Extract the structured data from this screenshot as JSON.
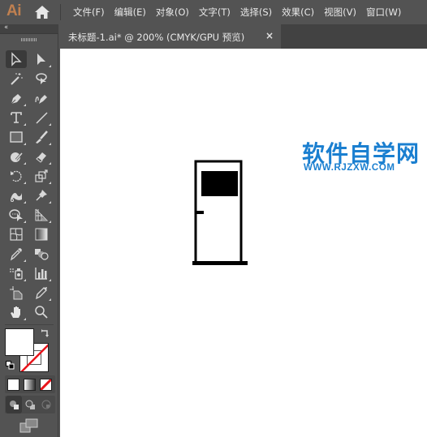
{
  "app": {
    "logo": "Ai",
    "home_icon": "home-icon"
  },
  "menu": [
    "文件(F)",
    "编辑(E)",
    "对象(O)",
    "文字(T)",
    "选择(S)",
    "效果(C)",
    "视图(V)",
    "窗口(W)"
  ],
  "panel": {
    "collapse_glyph": "‹‹"
  },
  "document_tab": {
    "title": "未标题-1.ai* @ 200% (CMYK/GPU 预览)",
    "close_glyph": "×"
  },
  "tools": [
    [
      "selection-tool",
      "direct-selection-tool"
    ],
    [
      "magic-wand-tool",
      "lasso-tool"
    ],
    [
      "pen-tool",
      "curvature-tool"
    ],
    [
      "type-tool",
      "line-segment-tool"
    ],
    [
      "rectangle-tool",
      "paintbrush-tool"
    ],
    [
      "shaper-tool",
      "eraser-tool"
    ],
    [
      "rotate-tool",
      "scale-tool"
    ],
    [
      "warp-tool",
      "puppet-warp-tool"
    ],
    [
      "shape-builder-tool",
      "perspective-grid-tool"
    ],
    [
      "mesh-tool",
      "gradient-tool"
    ],
    [
      "eyedropper-tool",
      "blend-tool"
    ],
    [
      "symbol-sprayer-tool",
      "column-graph-tool"
    ],
    [
      "artboard-tool",
      "slice-tool"
    ],
    [
      "hand-tool",
      "zoom-tool"
    ]
  ],
  "colors": {
    "fill": "#ffffff",
    "stroke": "none",
    "accent_watermark": "#1a7fd0",
    "none_slash": "#e8141b"
  },
  "artwork": {
    "description": "door illustration",
    "door_fill": "#ffffff",
    "door_stroke": "#000000"
  },
  "watermark": {
    "chinese": "软件自学网",
    "url": "WWW.RJZXW.COM"
  }
}
